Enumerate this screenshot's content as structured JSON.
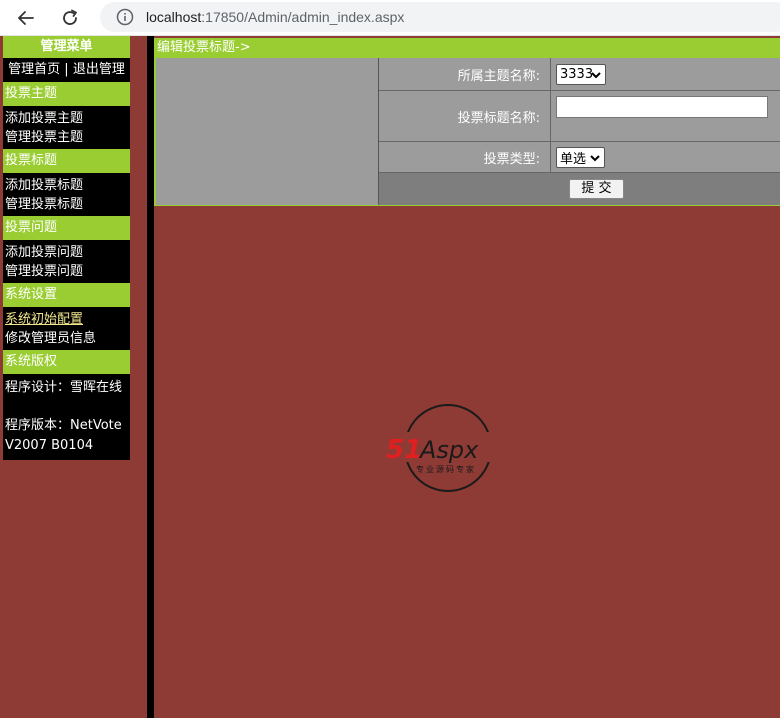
{
  "browser": {
    "url_host": "localhost",
    "url_rest": ":17850/Admin/admin_index.aspx"
  },
  "menu": {
    "title": "管理菜单",
    "home_link": "管理首页",
    "separator": "|",
    "logout_link": "退出管理",
    "sections": [
      {
        "title": "投票主题",
        "items": [
          "添加投票主题",
          "管理投票主题"
        ]
      },
      {
        "title": "投票标题",
        "items": [
          "添加投票标题",
          "管理投票标题"
        ]
      },
      {
        "title": "投票问题",
        "items": [
          "添加投票问题",
          "管理投票问题"
        ]
      },
      {
        "title": "系统设置",
        "items": [
          "系统初始配置",
          "修改管理员信息"
        ]
      }
    ],
    "copyright_title": "系统版权",
    "designer_line": "程序设计：雪晖在线",
    "version_line_1": "程序版本：NetVote",
    "version_line_2": "V2007 B0104"
  },
  "content": {
    "breadcrumb": "编辑投票标题->",
    "form": {
      "topic_label": "所属主题名称:",
      "topic_value": "3333",
      "title_label": "投票标题名称:",
      "title_value": "",
      "type_label": "投票类型:",
      "type_value": "单选",
      "submit_label": "提 交"
    }
  },
  "logo": {
    "brand_prefix": "51",
    "brand_text": "Aspx",
    "brand_suffix": "x",
    "tagline": "专业源码专家",
    "colors": {
      "red": "#e02020",
      "dark": "#1a1a1a",
      "green": "#2ea12e"
    }
  },
  "colors": {
    "menu_green": "#9acd32",
    "background": "#8e3a35",
    "form_gray": "#9c9c9c",
    "active_link": "#f0e68c"
  }
}
